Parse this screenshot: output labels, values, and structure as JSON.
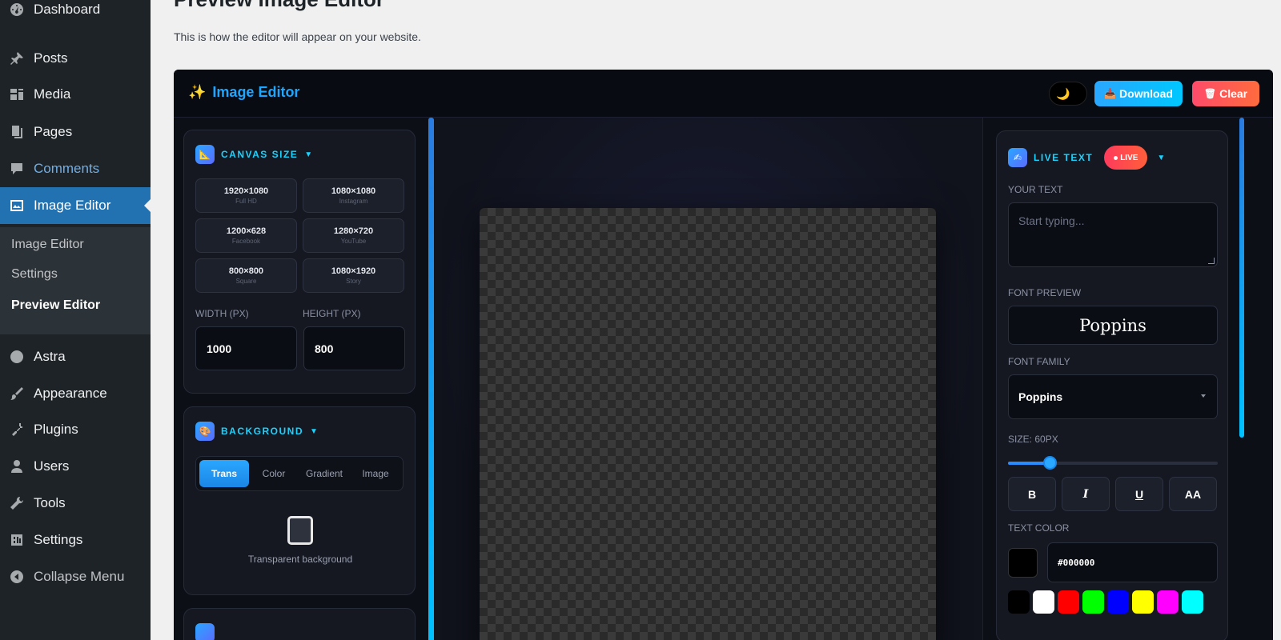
{
  "wp_nav": {
    "dashboard": "Dashboard",
    "posts": "Posts",
    "media": "Media",
    "pages": "Pages",
    "comments": "Comments",
    "image_editor": "Image Editor",
    "submenu": {
      "image_editor": "Image Editor",
      "settings": "Settings",
      "preview_editor": "Preview Editor"
    },
    "astra": "Astra",
    "appearance": "Appearance",
    "plugins": "Plugins",
    "users": "Users",
    "tools": "Tools",
    "settings": "Settings",
    "collapse": "Collapse Menu",
    "colors": {
      "bg": "#1d2327",
      "active": "#2271b1",
      "link": "#72aee6"
    }
  },
  "page": {
    "title": "Preview Image Editor",
    "description": "This is how the editor will appear on your website."
  },
  "editor": {
    "brand": "Image Editor",
    "brand_icon": "sparkles-icon",
    "theme_icon": "moon-icon",
    "download_label": "Download",
    "clear_label": "Clear",
    "accent": "#19d3ff"
  },
  "canvas_size": {
    "title": "CANVAS SIZE",
    "icon": "ruler-icon",
    "presets": [
      {
        "size": "1920×1080",
        "label": "Full HD"
      },
      {
        "size": "1080×1080",
        "label": "Instagram"
      },
      {
        "size": "1200×628",
        "label": "Facebook"
      },
      {
        "size": "1280×720",
        "label": "YouTube"
      },
      {
        "size": "800×800",
        "label": "Square"
      },
      {
        "size": "1080×1920",
        "label": "Story"
      }
    ],
    "width_label": "WIDTH (PX)",
    "height_label": "HEIGHT (PX)",
    "width_value": "1000",
    "height_value": "800"
  },
  "background": {
    "title": "BACKGROUND",
    "icon": "palette-icon",
    "tabs": [
      "Trans",
      "Color",
      "Gradient",
      "Image"
    ],
    "active_tab": "Trans",
    "transparent_label": "Transparent background"
  },
  "live_text": {
    "title": "LIVE TEXT",
    "icon": "text-icon",
    "badge": "LIVE",
    "your_text_label": "YOUR TEXT",
    "placeholder": "Start typing...",
    "font_preview_label": "FONT PREVIEW",
    "font_preview_text": "Poppins",
    "font_family_label": "FONT FAMILY",
    "font_family_value": "Poppins",
    "size_label": "SIZE: 60PX",
    "size_fraction": 0.2,
    "format_buttons": [
      "B",
      "I",
      "U",
      "AA"
    ],
    "text_color_label": "TEXT COLOR",
    "text_color_value": "#000000",
    "swatches": [
      "#000000",
      "#ffffff",
      "#ff0000",
      "#00ff00",
      "#0000ff",
      "#ffff00",
      "#ff00ff",
      "#00ffff"
    ]
  }
}
